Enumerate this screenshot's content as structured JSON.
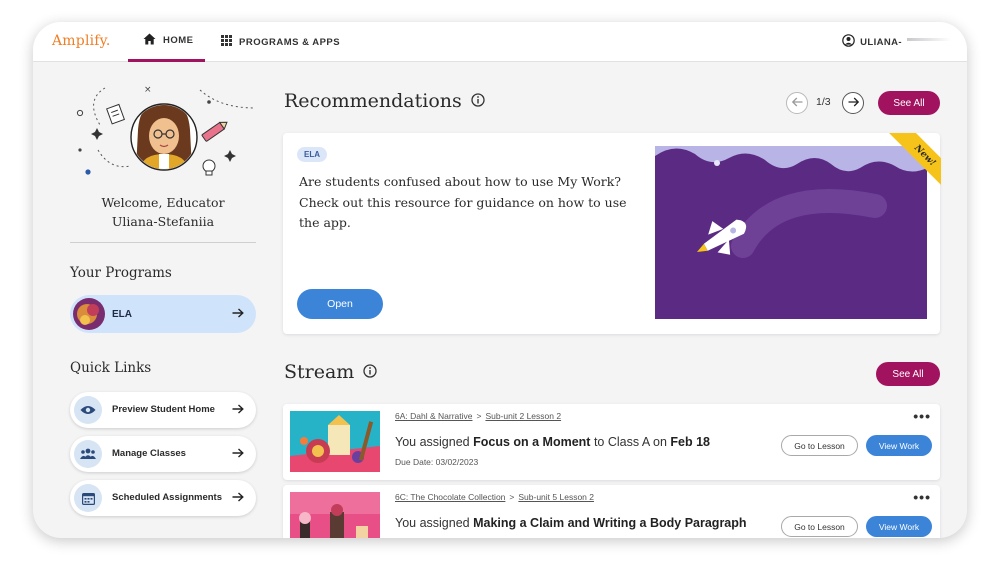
{
  "app": {
    "logo": "Amplify.",
    "brand_color": "#f07e26",
    "accent_color": "#a2135f"
  },
  "nav": {
    "tabs": [
      {
        "label": "HOME",
        "icon": "home-icon",
        "active": true
      },
      {
        "label": "PROGRAMS & APPS",
        "icon": "grid-icon",
        "active": false
      }
    ],
    "user_name": "ULIANA-"
  },
  "sidebar": {
    "welcome_line1": "Welcome, Educator",
    "welcome_line2": "Uliana-Stefaniia",
    "programs_title": "Your Programs",
    "programs": [
      {
        "label": "ELA"
      }
    ],
    "quick_links_title": "Quick Links",
    "quick_links": [
      {
        "label": "Preview Student Home",
        "icon": "eye-icon"
      },
      {
        "label": "Manage Classes",
        "icon": "people-icon"
      },
      {
        "label": "Scheduled Assignments",
        "icon": "calendar-icon"
      }
    ]
  },
  "recommendations": {
    "title": "Recommendations",
    "pager": "1/3",
    "see_all": "See All",
    "card": {
      "badge": "ELA",
      "ribbon": "New!",
      "text": "Are students confused about how to use My Work? Check out this resource for guidance on how to use the app.",
      "open_label": "Open"
    }
  },
  "stream": {
    "title": "Stream",
    "see_all": "See All",
    "items": [
      {
        "crumb_unit": "6A: Dahl & Narrative",
        "crumb_lesson": "Sub-unit 2 Lesson 2",
        "prefix": "You assigned",
        "lesson": "Focus on a Moment",
        "mid": "to Class A on",
        "date": "Feb 18",
        "due": "Due Date: 03/02/2023",
        "goto_label": "Go to Lesson",
        "view_label": "View Work"
      },
      {
        "crumb_unit": "6C: The Chocolate Collection",
        "crumb_lesson": "Sub-unit 5 Lesson 2",
        "prefix": "You assigned",
        "lesson": "Making a Claim and Writing a Body Paragraph",
        "goto_label": "Go to Lesson",
        "view_label": "View Work"
      }
    ]
  }
}
